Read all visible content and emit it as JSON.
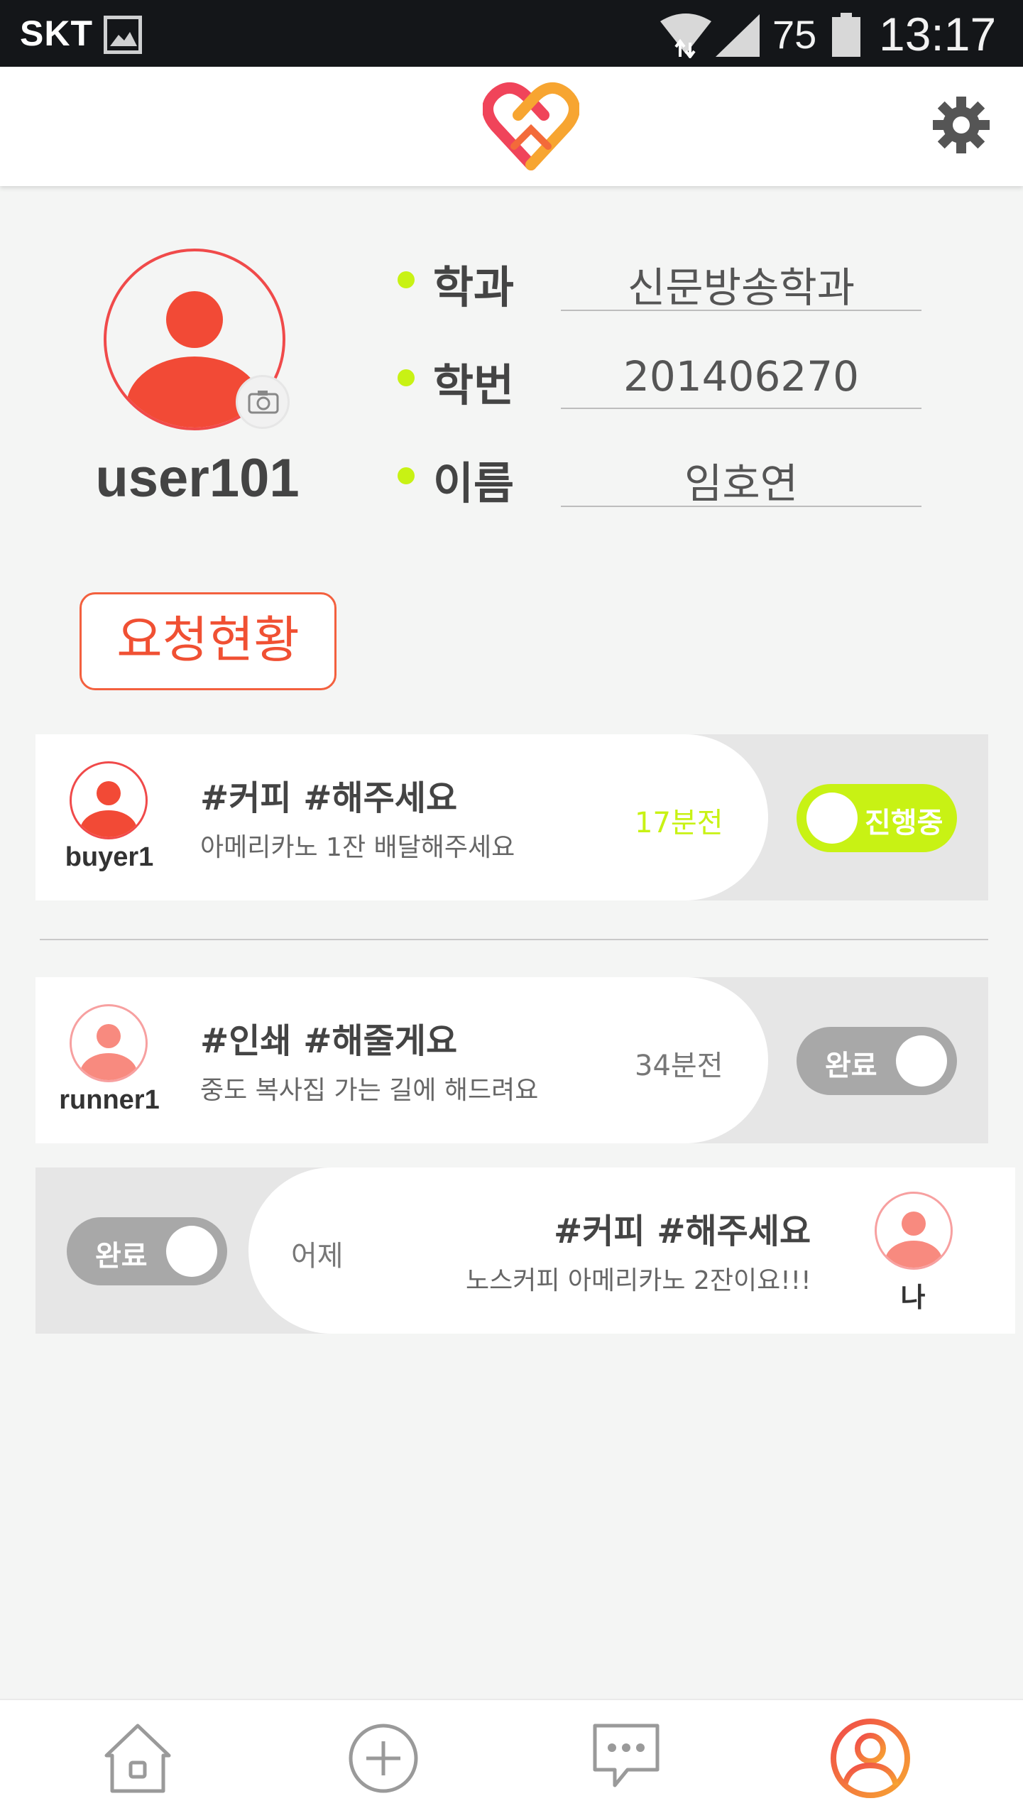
{
  "status_bar": {
    "carrier": "SKT",
    "battery_percent": "75",
    "time": "13:17",
    "icons": [
      "gallery-icon",
      "wifi-icon",
      "signal-icon",
      "battery-icon"
    ]
  },
  "header": {
    "logo": "heart-logo-icon",
    "settings": "gear-icon"
  },
  "profile": {
    "username": "user101",
    "fields": [
      {
        "label": "학과",
        "value": "신문방송학과"
      },
      {
        "label": "학번",
        "value": "201406270"
      },
      {
        "label": "이름",
        "value": "임호연"
      }
    ]
  },
  "request_status_button": "요청현황",
  "requests": [
    {
      "user": "buyer1",
      "tags": "#커피  #해주세요",
      "description": "아메리카노 1잔 배달해주세요",
      "time": "17분전",
      "status": "진행중",
      "status_color": "#c8f214"
    },
    {
      "user": "runner1",
      "tags": "#인쇄  #해줄게요",
      "description": "중도 복사집 가는 길에 해드려요",
      "time": "34분전",
      "status": "완료",
      "status_color": "#a8a8a8"
    },
    {
      "user": "나",
      "tags": "#커피  #해주세요",
      "description": "노스커피 아메리카노 2잔이요!!!",
      "time": "어제",
      "status": "완료",
      "status_color": "#a8a8a8"
    }
  ],
  "bottom_nav": [
    "home-icon",
    "add-icon",
    "chat-icon",
    "profile-icon"
  ],
  "colors": {
    "accent_red": "#f04a4a",
    "accent_orange": "#f7a531",
    "active_green": "#c8f214"
  }
}
